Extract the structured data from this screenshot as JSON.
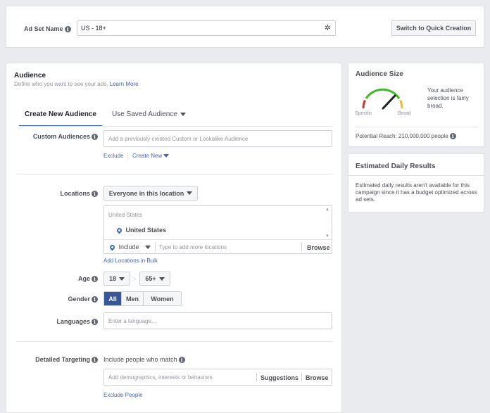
{
  "adset": {
    "name_label": "Ad Set Name",
    "name_value": "US - 18+",
    "switch_label": "Switch to Quick Creation"
  },
  "audience": {
    "title": "Audience",
    "subtitle": "Define who you want to see your ads.",
    "learn_more": "Learn More",
    "tabs": {
      "create": "Create New Audience",
      "saved": "Use Saved Audience"
    },
    "custom": {
      "label": "Custom Audiences",
      "placeholder": "Add a previously created Custom or Lookalike Audience",
      "exclude": "Exclude",
      "create_new": "Create New"
    },
    "locations": {
      "label": "Locations",
      "dropdown": "Everyone in this location",
      "header": "United States",
      "item": "United States",
      "include": "Include",
      "placeholder": "Type to add more locations",
      "browse": "Browse",
      "bulk": "Add Locations in Bulk"
    },
    "age": {
      "label": "Age",
      "min": "18",
      "dash": "-",
      "max": "65+"
    },
    "gender": {
      "label": "Gender",
      "options": [
        "All",
        "Men",
        "Women"
      ],
      "selected": "All"
    },
    "languages": {
      "label": "Languages",
      "placeholder": "Enter a language..."
    },
    "detailed": {
      "label": "Detailed Targeting",
      "include_text": "Include people who match",
      "placeholder": "Add demographics, interests or behaviors",
      "suggestions": "Suggestions",
      "browse": "Browse",
      "exclude": "Exclude People"
    }
  },
  "audience_size": {
    "title": "Audience Size",
    "description": "Your audience selection is fairly broad.",
    "specific": "Specific",
    "broad": "Broad",
    "reach": "Potential Reach: 210,000,000 people"
  },
  "estimated": {
    "title": "Estimated Daily Results",
    "text": "Estimated daily results aren't available for this campaign since it has a budget optimized across ad sets."
  },
  "colors": {
    "accent": "#4267b2",
    "selected": "#365899",
    "gauge_red": "#d93025",
    "gauge_green": "#42b72a",
    "gauge_orange": "#f7b928"
  }
}
